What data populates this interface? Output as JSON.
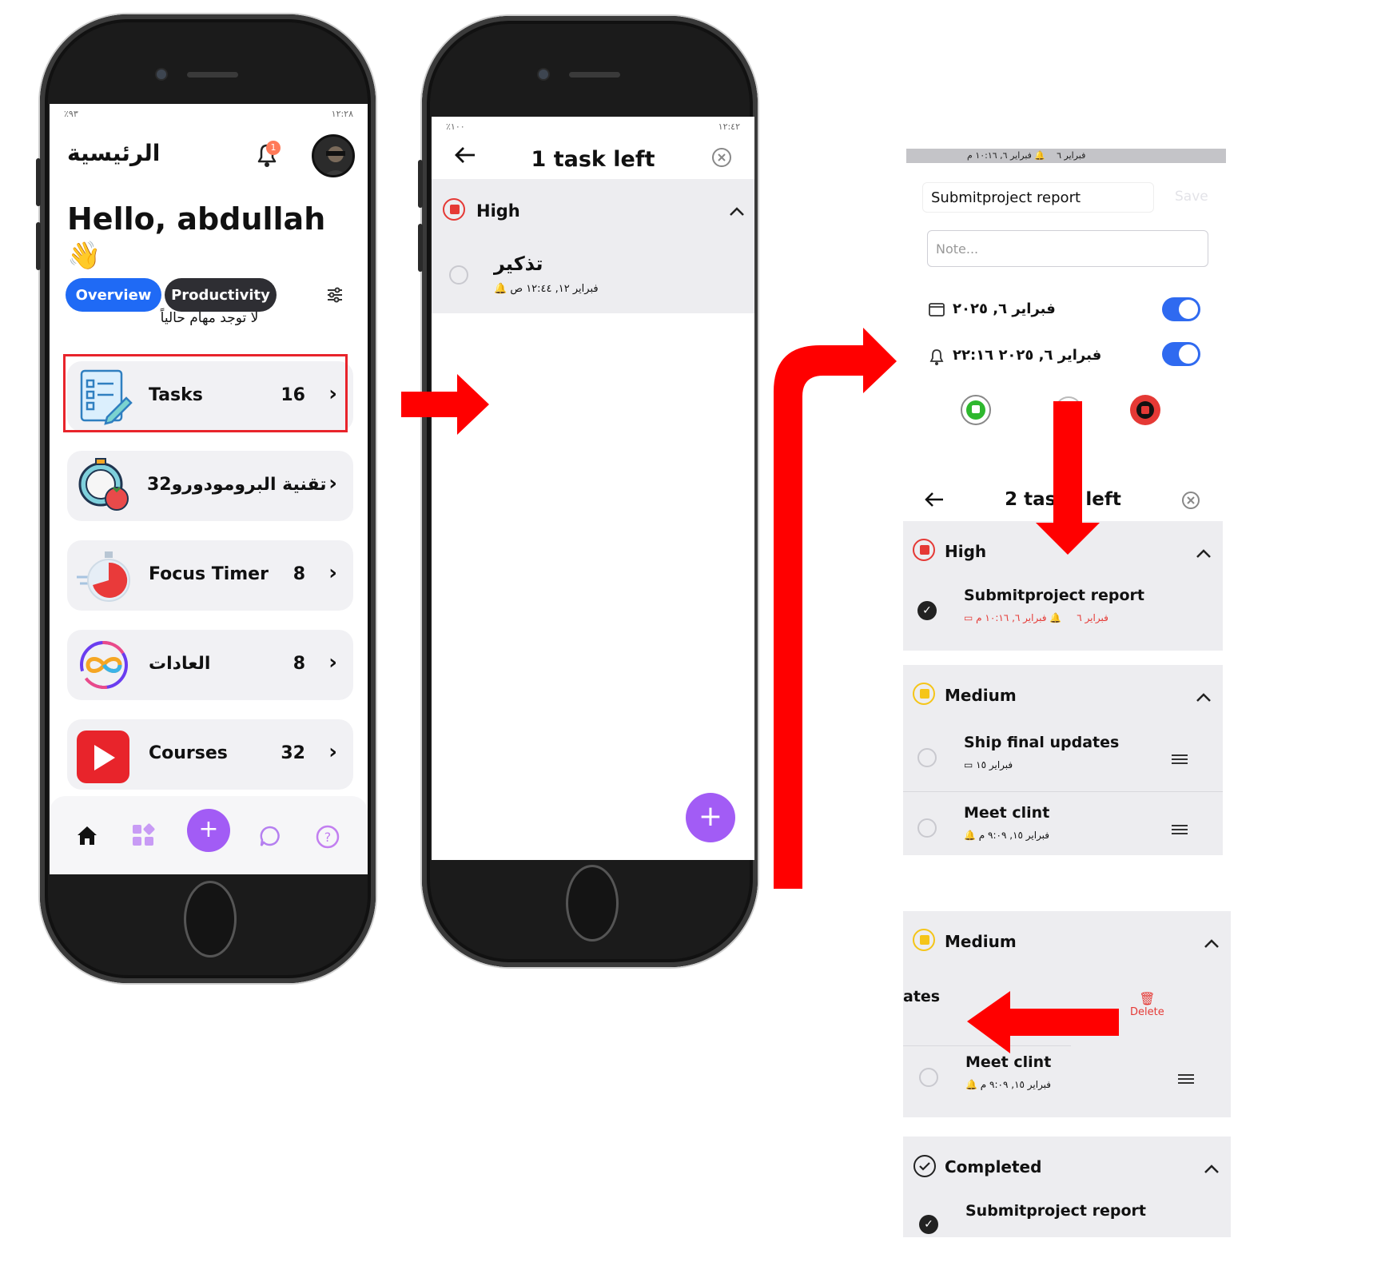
{
  "phone1": {
    "status_left": "٪٩٣",
    "status_right": "١٢:٢٨",
    "title": "الرئيسية",
    "notification_count": "1",
    "greeting": "Hello, abdullah",
    "greeting_emoji": "👋",
    "tabs": [
      {
        "label": "Overview"
      },
      {
        "label": "Productivity"
      }
    ],
    "no_tasks_text": "لا توجد مهام حالياً",
    "cards": [
      {
        "label": "Tasks",
        "count": "16"
      },
      {
        "label": "تقنية البرومودورو",
        "count": "32"
      },
      {
        "label": "Focus Timer",
        "count": "8"
      },
      {
        "label": "العادات",
        "count": "8"
      },
      {
        "label": "Courses",
        "count": "32"
      }
    ],
    "fab_symbol": "+"
  },
  "phone2": {
    "status_left": "٪١٠٠",
    "status_right": "١٢:٤٢",
    "title": "1 task left",
    "section_label": "High",
    "task_title": "تذكير",
    "task_sub": "فبراير ١٢, ١٢:٤٤ ص",
    "fab_symbol": "+"
  },
  "edit_panel": {
    "top_strip_date": "فبراير ٦",
    "top_strip_reminder": "فبراير ٦, ١٠:١٦ م",
    "title_value": "Submitproject report",
    "save_label": "Save",
    "note_placeholder": "Note...",
    "date_text": "فبراير ٦, ٢٠٢٥",
    "reminder_text": "فبراير ٦, ٢٠٢٥ ٢٢:١٦"
  },
  "list_panel": {
    "title": "2 tasks left",
    "sections": [
      {
        "label": "High",
        "tasks": [
          {
            "title": "Submitproject report",
            "date": "فبراير ٦",
            "reminder": "فبراير ٦, ١٠:١٦ م"
          }
        ]
      },
      {
        "label": "Medium",
        "tasks": [
          {
            "title": "Ship final updates",
            "date": "فبراير ١٥"
          },
          {
            "title": "Meet clint",
            "reminder": "فبراير ١٥, ٩:٠٩ م"
          }
        ]
      }
    ]
  },
  "swipe_panel": {
    "section_label": "Medium",
    "swiped_text": "ates",
    "delete_label": "Delete",
    "task_title": "Meet clint",
    "task_reminder": "فبراير ١٥, ٩:٠٩ م",
    "completed_label": "Completed",
    "completed_task": "Submitproject report"
  },
  "colors": {
    "primary_blue": "#2f6af0",
    "accent_purple": "#a25cf5",
    "arrow_red": "#ff0000",
    "flag_red": "#e53935",
    "flag_yellow": "#f5c518",
    "flag_green": "#2eb82e"
  }
}
